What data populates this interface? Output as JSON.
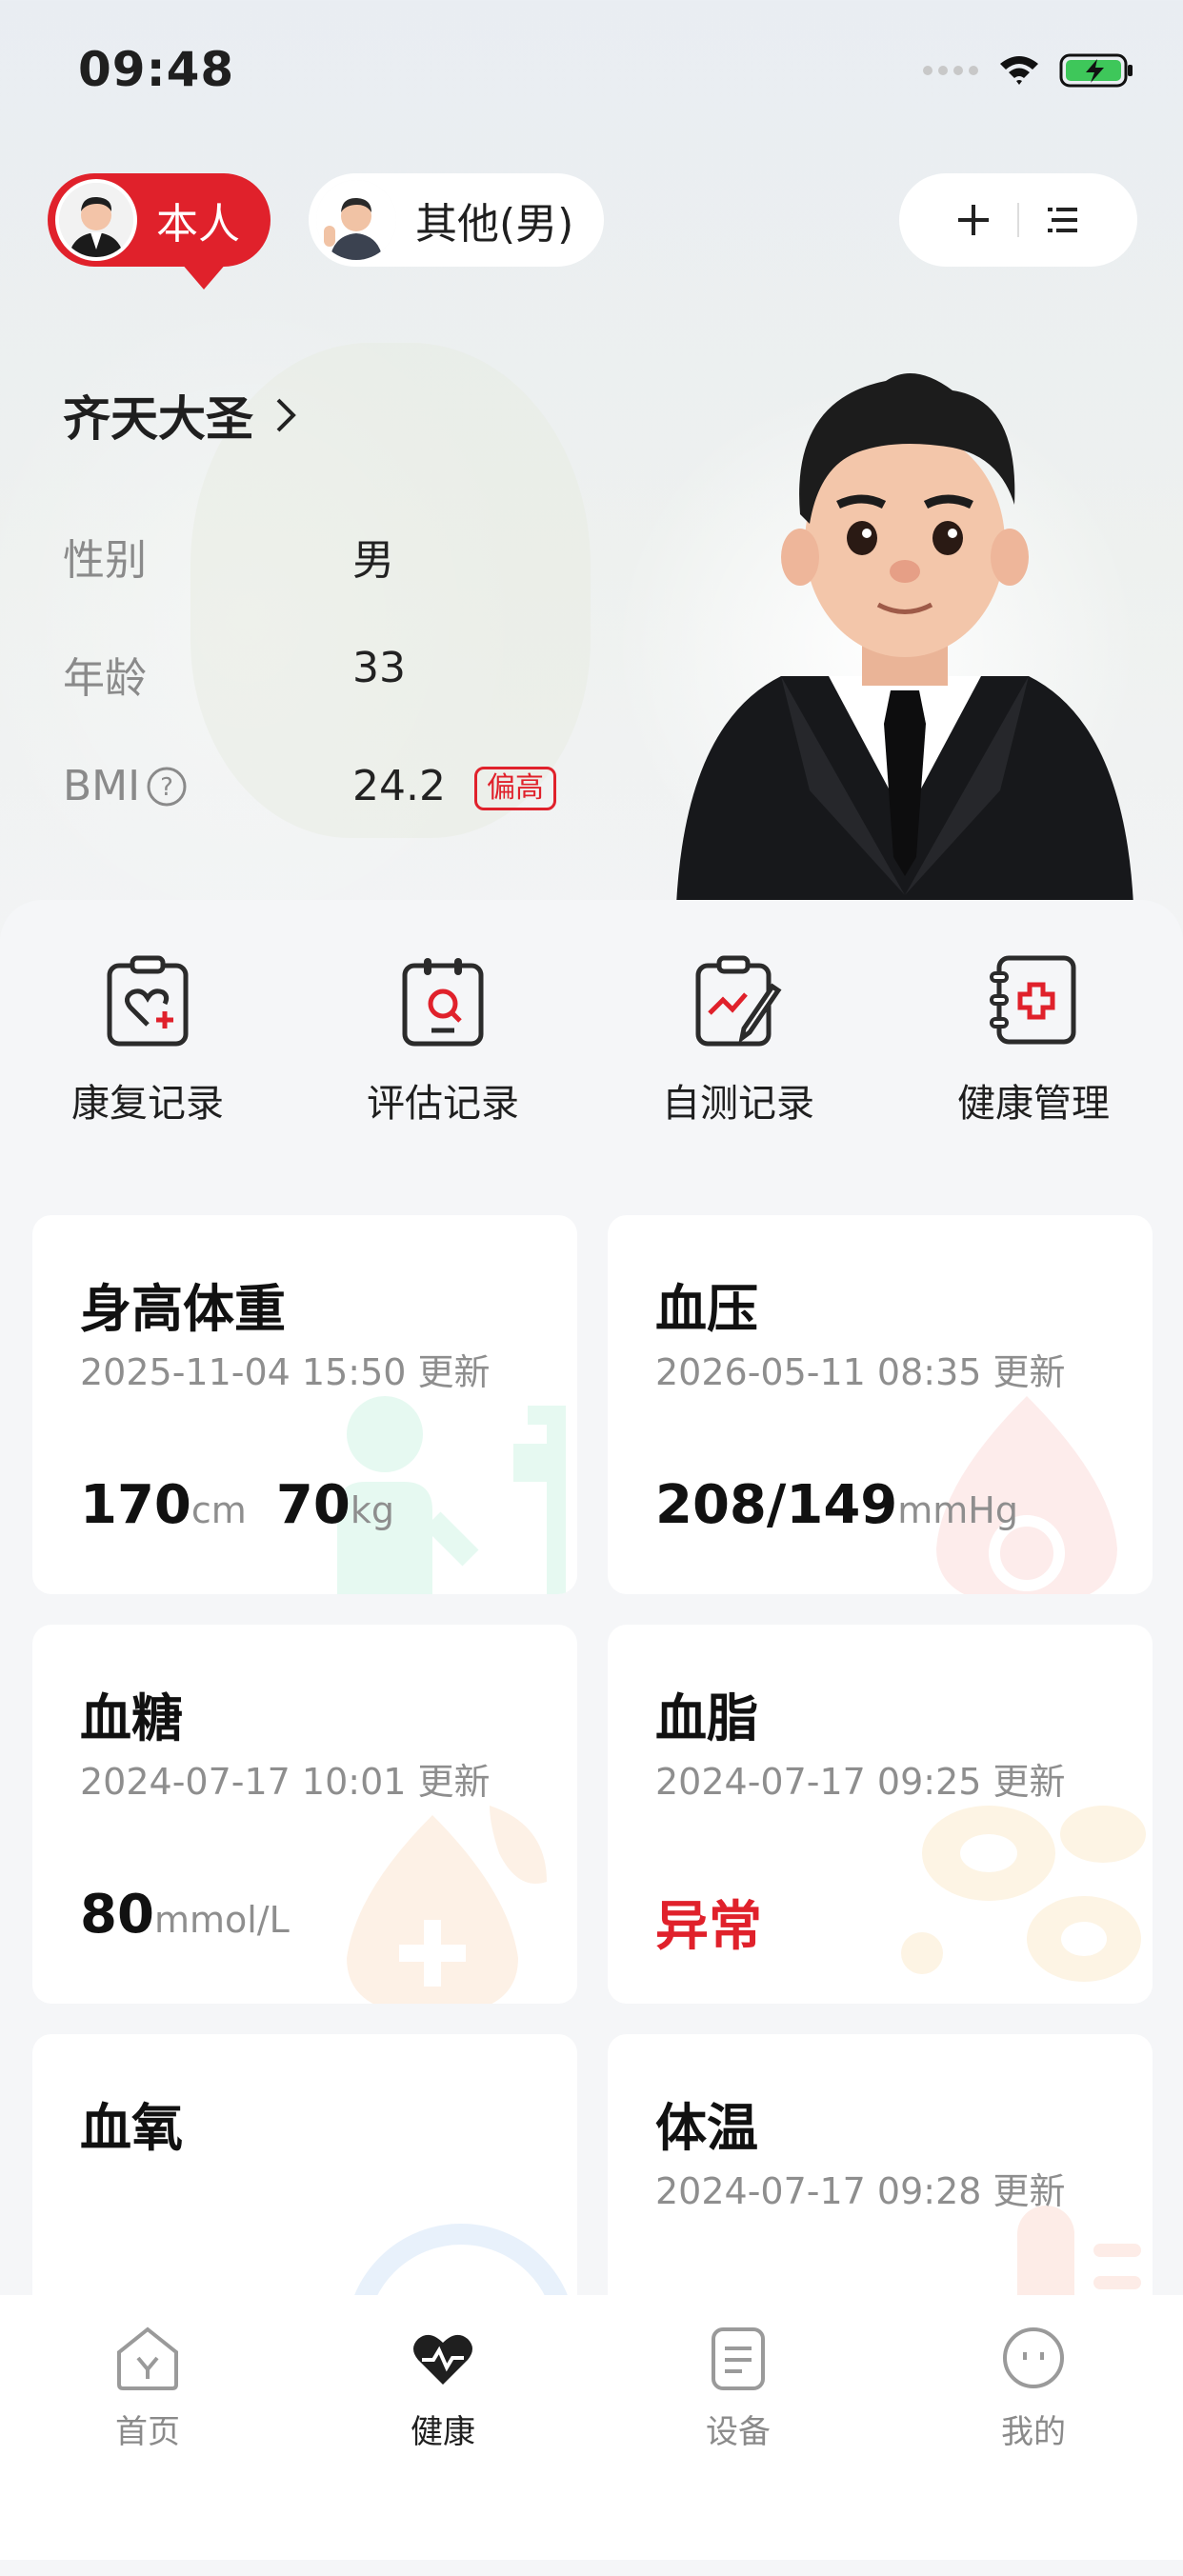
{
  "status": {
    "time": "09:48"
  },
  "profiles": {
    "self_label": "本人",
    "other_label": "其他(男)"
  },
  "profile": {
    "name": "齐天大圣",
    "rows": [
      {
        "label": "性别",
        "value": "男"
      },
      {
        "label": "年龄",
        "value": "33"
      },
      {
        "label": "BMI",
        "value": "24.2",
        "tag": "偏高"
      }
    ]
  },
  "quick_actions": [
    {
      "label": "康复记录",
      "icon": "heart-clipboard-icon"
    },
    {
      "label": "评估记录",
      "icon": "search-clipboard-icon"
    },
    {
      "label": "自测记录",
      "icon": "chart-pen-clipboard-icon"
    },
    {
      "label": "健康管理",
      "icon": "medical-folder-icon"
    }
  ],
  "cards": {
    "height_weight": {
      "title": "身高体重",
      "time": "2025-11-04 15:50 更新",
      "height": "170",
      "height_unit": "cm",
      "weight": "70",
      "weight_unit": "kg"
    },
    "blood_pressure": {
      "title": "血压",
      "time": "2026-05-11 08:35 更新",
      "value": "208/149",
      "unit": "mmHg"
    },
    "blood_sugar": {
      "title": "血糖",
      "time": "2024-07-17 10:01 更新",
      "value": "80",
      "unit": "mmol/L"
    },
    "blood_lipid": {
      "title": "血脂",
      "time": "2024-07-17 09:25 更新",
      "status": "异常"
    },
    "blood_oxygen": {
      "title": "血氧"
    },
    "temperature": {
      "title": "体温",
      "time": "2024-07-17 09:28 更新"
    }
  },
  "tabs": [
    {
      "label": "首页",
      "icon": "home-icon"
    },
    {
      "label": "健康",
      "icon": "heart-pulse-icon",
      "active": true
    },
    {
      "label": "设备",
      "icon": "device-icon"
    },
    {
      "label": "我的",
      "icon": "profile-face-icon"
    }
  ],
  "colors": {
    "accent": "#e0212b",
    "text": "#1f1f1f",
    "muted": "#8e8e8e"
  }
}
